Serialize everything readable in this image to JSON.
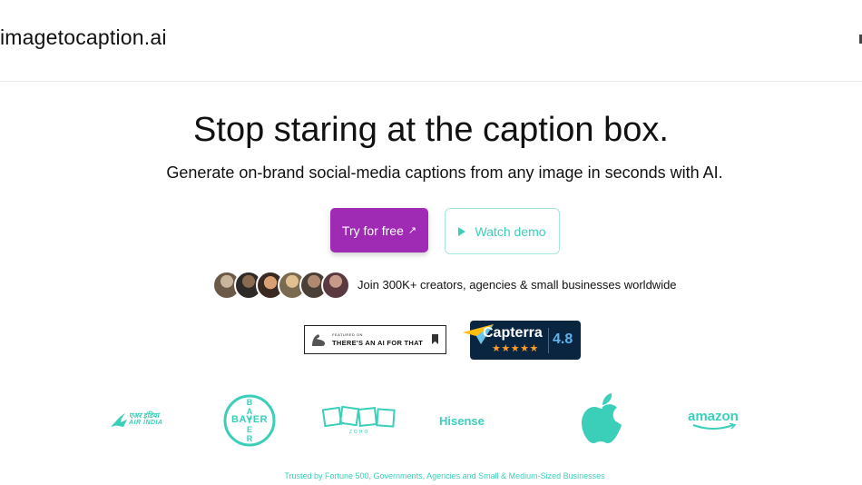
{
  "header": {
    "logo_text": "imagetocaption.ai"
  },
  "hero": {
    "title": "Stop staring at the caption box.",
    "subtitle": "Generate on-brand social-media captions from any image in seconds with AI."
  },
  "cta": {
    "primary_label": "Try for free",
    "primary_icon": "arrow-up-right-icon",
    "secondary_label": "Watch demo",
    "secondary_icon": "play-icon"
  },
  "social_proof": {
    "avatar_count": 6,
    "join_text": "Join 300K+ creators, agencies & small businesses worldwide"
  },
  "badges": {
    "aift_small": "FEATURED ON",
    "aift_big": "THERE'S AN AI FOR THAT",
    "capterra_name": "Capterra",
    "capterra_stars": "★★★★★",
    "capterra_rating": "4.8"
  },
  "brands": {
    "air_india_script": "एअर इंडिया",
    "air_india": "AIR INDIA",
    "bayer": "BAYER",
    "zoho": "ZOHO",
    "hisense": "Hisense",
    "apple_icon": "apple-logo-icon",
    "amazon": "amazon"
  },
  "footer": {
    "trusted_text": "Trusted by Fortune 500, Governments, Agencies and Small & Medium-Sized Businesses"
  },
  "colors": {
    "primary": "#9f2ab3",
    "accent": "#3bcfba",
    "capterra_bg": "#0a2540",
    "star": "#ff9d28"
  }
}
